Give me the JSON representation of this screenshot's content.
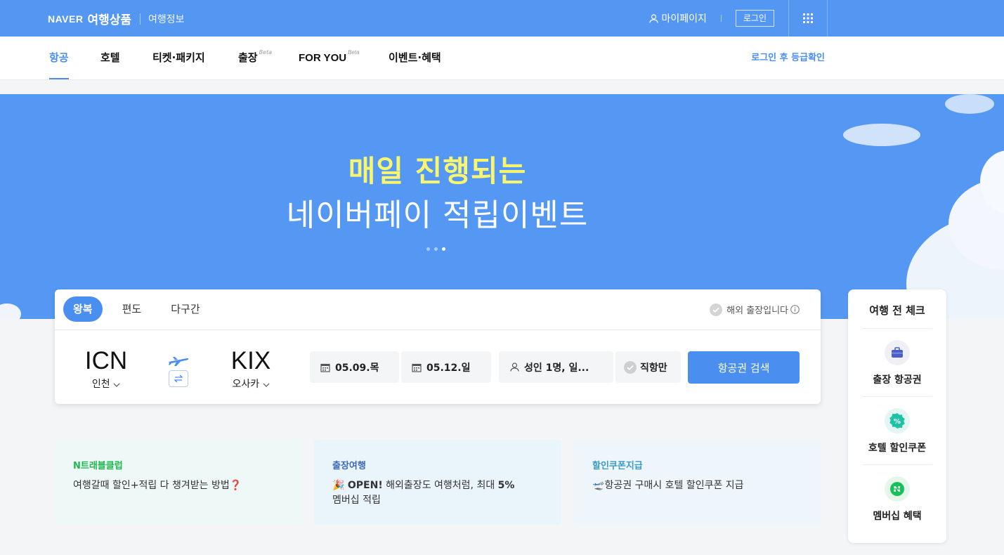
{
  "header": {
    "brand": "NAVER",
    "product": "여행상품",
    "info_link": "여행정보",
    "mypage": "마이페이지",
    "login": "로그인"
  },
  "nav": {
    "items": [
      {
        "label": "항공",
        "beta": ""
      },
      {
        "label": "호텔",
        "beta": ""
      },
      {
        "label": "티켓·패키지",
        "beta": ""
      },
      {
        "label": "출장",
        "beta": "Beta"
      },
      {
        "label": "FOR YOU",
        "beta": "Beta"
      },
      {
        "label": "이벤트·혜택",
        "beta": ""
      }
    ],
    "right_link": "로그인 후 등급확인"
  },
  "hero": {
    "line1": "매일 진행되는",
    "line2": "네이버페이 적립이벤트",
    "slide_count": 3,
    "active_slide": 3
  },
  "search": {
    "tabs": [
      "왕복",
      "편도",
      "다구간"
    ],
    "business_check": "해외 출장입니다",
    "origin": {
      "code": "ICN",
      "city": "인천"
    },
    "destination": {
      "code": "KIX",
      "city": "오사카"
    },
    "depart_date": "05.09.목",
    "return_date": "05.12.일",
    "passengers": "성인 1명, 일...",
    "direct_only": "직항만",
    "search_button": "항공권 검색"
  },
  "promos": [
    {
      "title": "N트래블클럽",
      "desc": "여행갈때 할인+적립 다 챙겨받는 방법",
      "emoji": "❓",
      "title_color": "#1fb84f",
      "bg": "#eef8f6"
    },
    {
      "title": "출장여행",
      "emoji": "🎉",
      "desc_bold": "OPEN!",
      "desc": " 해외출장도 여행처럼, 최대 ",
      "desc_bold2": "5%",
      "desc2": "멤버십 적립",
      "title_color": "#3d6bb5",
      "bg": "#eaf4fb"
    },
    {
      "title": "할인쿠폰지급",
      "emoji": "🛫",
      "desc": "항공권 구매시 호텔 할인쿠폰 지급",
      "title_color": "#3a9bc4",
      "bg": "#eef6fb"
    }
  ],
  "side": {
    "title": "여행 전 체크",
    "items": [
      {
        "label": "출장 항공권",
        "icon": "briefcase-icon"
      },
      {
        "label": "호텔 할인쿠폰",
        "icon": "percent-badge-icon"
      },
      {
        "label": "멤버십 혜택",
        "icon": "naver-membership-icon"
      }
    ]
  },
  "colors": {
    "brand_blue": "#5497f3",
    "accent": "#4a8ef0",
    "hero_yellow": "#f8f56e"
  }
}
